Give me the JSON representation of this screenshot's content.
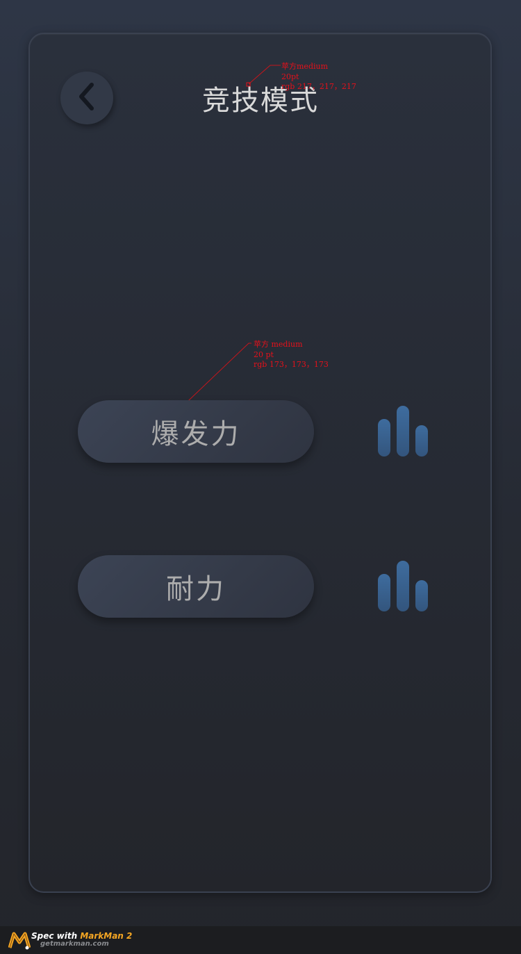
{
  "header": {
    "title": "竞技模式",
    "back_icon": "chevron-left-icon"
  },
  "annotations": {
    "title_spec": [
      "苹方medium",
      "20pt",
      "rgb 217，217，217"
    ],
    "button_spec": [
      "苹方 medium",
      "20 pt",
      "rgb 173，173，173"
    ]
  },
  "modes": [
    {
      "label": "爆发力",
      "icon": "bar-chart-icon"
    },
    {
      "label": "耐力",
      "icon": "bar-chart-icon"
    }
  ],
  "colors": {
    "title_text": "#d9d9d9",
    "button_text": "#adadad",
    "bar_color": "#3a6594",
    "annotation": "#e8101a"
  },
  "footer": {
    "brand_prefix": "Spec with ",
    "brand_name": "MarkMan 2",
    "url": "getmarkman.com"
  }
}
